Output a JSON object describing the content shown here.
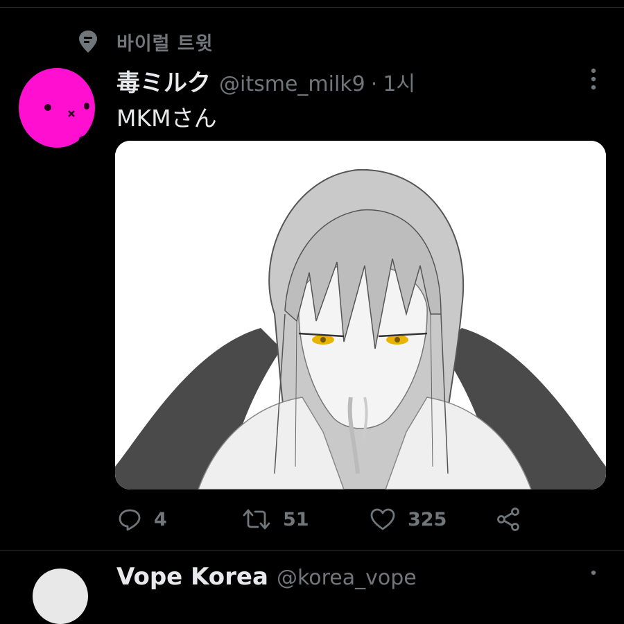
{
  "viral": {
    "label": "바이럴 트윗",
    "icon": "location-pin-icon"
  },
  "tweet": {
    "display_name": "毒ミルク",
    "handle": "@itsme_milk9",
    "separator": "·",
    "time": "1시",
    "text": "MKMさん",
    "media_description_icon": "anime-illustration-image",
    "actions": {
      "replies": "4",
      "retweets": "51",
      "likes": "325"
    }
  },
  "next_tweet": {
    "display_name": "Vope Korea",
    "handle": "@korea_vope"
  },
  "colors": {
    "background": "#000000",
    "primary_text": "#e7e9ea",
    "secondary_text": "#71767b",
    "divider": "#2f3336",
    "avatar_bg": "#ff10d0"
  }
}
